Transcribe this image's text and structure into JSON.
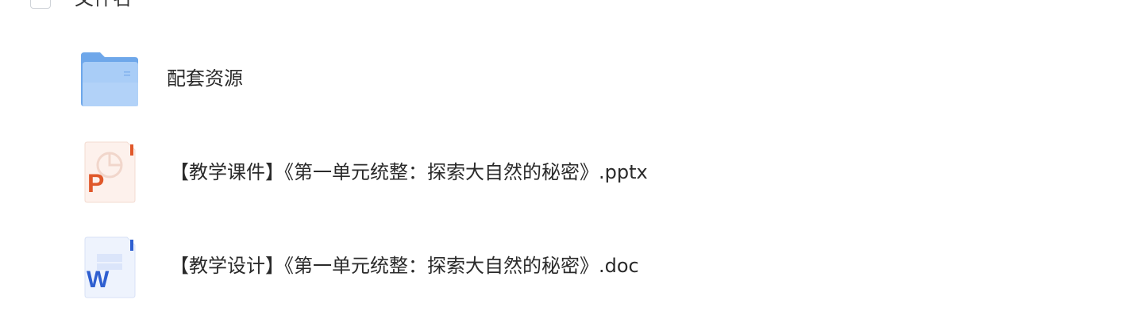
{
  "header": {
    "column_label": "文件名"
  },
  "files": [
    {
      "name": "配套资源",
      "type": "folder",
      "icon": "folder-icon"
    },
    {
      "name": "【教学课件】《第一单元统整：探索大自然的秘密》.pptx",
      "type": "pptx",
      "icon": "powerpoint-file-icon",
      "icon_letter": "P"
    },
    {
      "name": "【教学设计】《第一单元统整：探索大自然的秘密》.doc",
      "type": "doc",
      "icon": "word-file-icon",
      "icon_letter": "W"
    }
  ],
  "colors": {
    "folder_back": "#6ea7ea",
    "folder_front": "#a9cdf7",
    "ppt_accent": "#e0582a",
    "ppt_bg": "#fdf1ec",
    "word_accent": "#2f5fd0",
    "word_bg": "#eef3fd"
  }
}
